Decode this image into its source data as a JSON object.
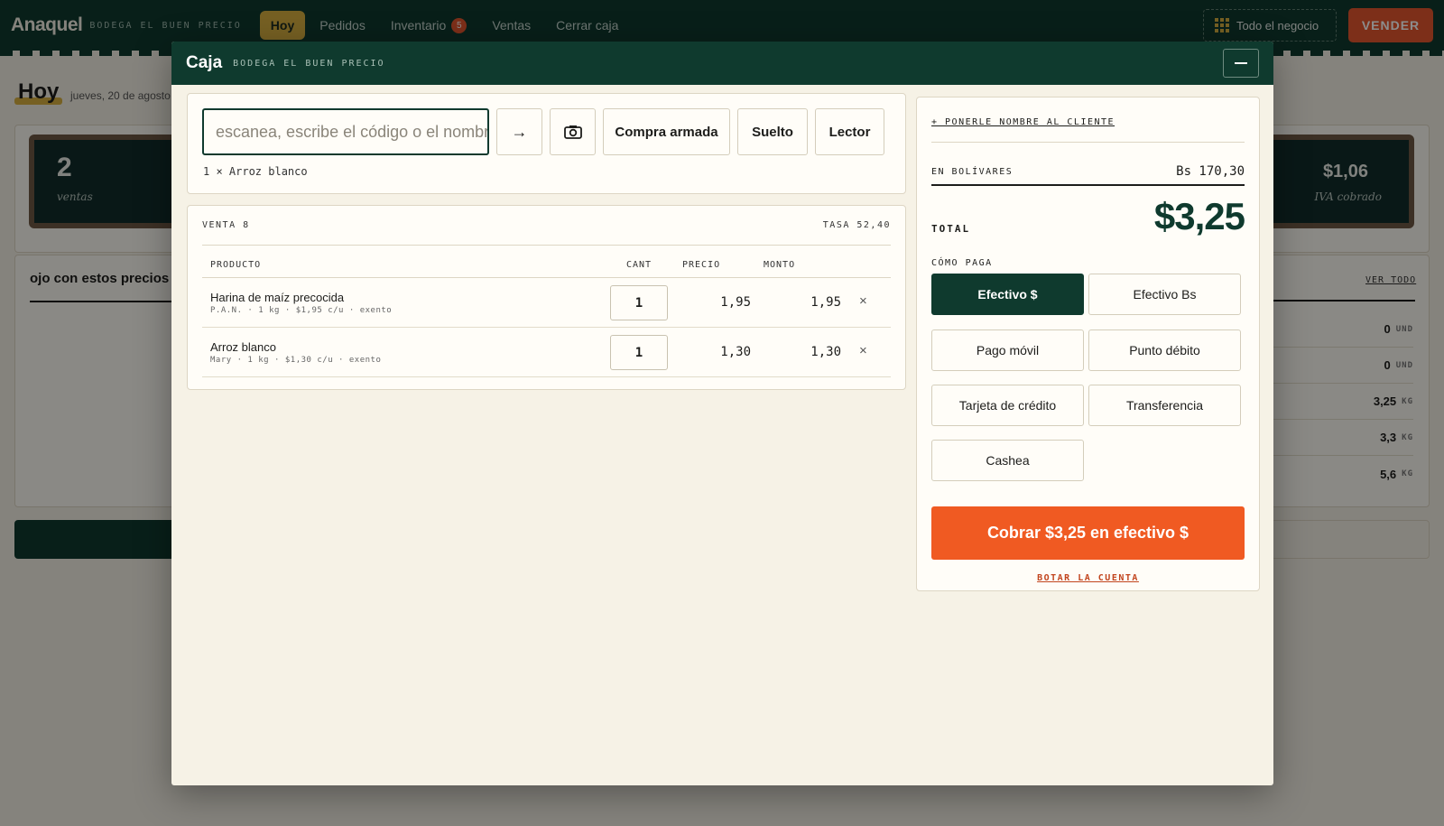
{
  "app": {
    "brand": "Anaquel",
    "store": "BODEGA EL BUEN PRECIO",
    "nav": [
      {
        "label": "Hoy"
      },
      {
        "label": "Pedidos"
      },
      {
        "label": "Inventario",
        "badge": "5"
      },
      {
        "label": "Ventas"
      },
      {
        "label": "Cerrar caja"
      }
    ],
    "business_switch": "Todo el negocio",
    "sell_button": "VENDER",
    "colors": {
      "primary": "#0f3a2e",
      "accent": "#f05a22",
      "highlight": "#d8b040"
    }
  },
  "background": {
    "title": "Hoy",
    "date": "jueves, 20 de agosto",
    "stat_left": {
      "value": "2",
      "label": "ventas"
    },
    "stat_right": {
      "value": "$1,06",
      "label": "IVA cobrado"
    },
    "list_title": "ojo con estos precios",
    "see_all": "VER TODO",
    "stock_rows": [
      {
        "value": "0",
        "unit": "UND"
      },
      {
        "value": "0",
        "unit": "UND"
      },
      {
        "value": "3,25",
        "unit": "KG"
      },
      {
        "value": "3,3",
        "unit": "KG"
      },
      {
        "value": "5,6",
        "unit": "KG"
      }
    ]
  },
  "modal": {
    "title": "Caja",
    "store": "BODEGA EL BUEN PRECIO",
    "search": {
      "placeholder": "escanea, escribe el código o el nombre",
      "buttons": {
        "submit": "→",
        "combo": "Compra armada",
        "loose": "Suelto",
        "reader": "Lector"
      },
      "last_added": "1 × Arroz blanco"
    },
    "sale": {
      "label": "VENTA 8",
      "rate": "TASA 52,40",
      "columns": {
        "product": "PRODUCTO",
        "qty": "CANT",
        "price": "PRECIO",
        "amount": "MONTO"
      },
      "items": [
        {
          "name": "Harina de maíz precocida",
          "meta": "P.A.N. · 1 kg · $1,95 c/u · exento",
          "qty": "1",
          "price": "1,95",
          "amount": "1,95",
          "remove": "×"
        },
        {
          "name": "Arroz blanco",
          "meta": "Mary · 1 kg · $1,30 c/u · exento",
          "qty": "1",
          "price": "1,30",
          "amount": "1,30",
          "remove": "×"
        }
      ]
    },
    "payment": {
      "customer_link": "+ PONERLE NOMBRE AL CLIENTE",
      "bs_label": "EN BOLÍVARES",
      "bs_value": "Bs 170,30",
      "total_label": "TOTAL",
      "total_value": "$3,25",
      "method_label": "CÓMO PAGA",
      "methods": [
        {
          "label": "Efectivo $",
          "selected": true
        },
        {
          "label": "Efectivo Bs"
        },
        {
          "label": "Pago móvil"
        },
        {
          "label": "Punto débito"
        },
        {
          "label": "Tarjeta de crédito"
        },
        {
          "label": "Transferencia"
        },
        {
          "label": "Cashea"
        }
      ],
      "charge_button": "Cobrar $3,25 en efectivo $",
      "void_link": "BOTAR LA CUENTA"
    }
  }
}
